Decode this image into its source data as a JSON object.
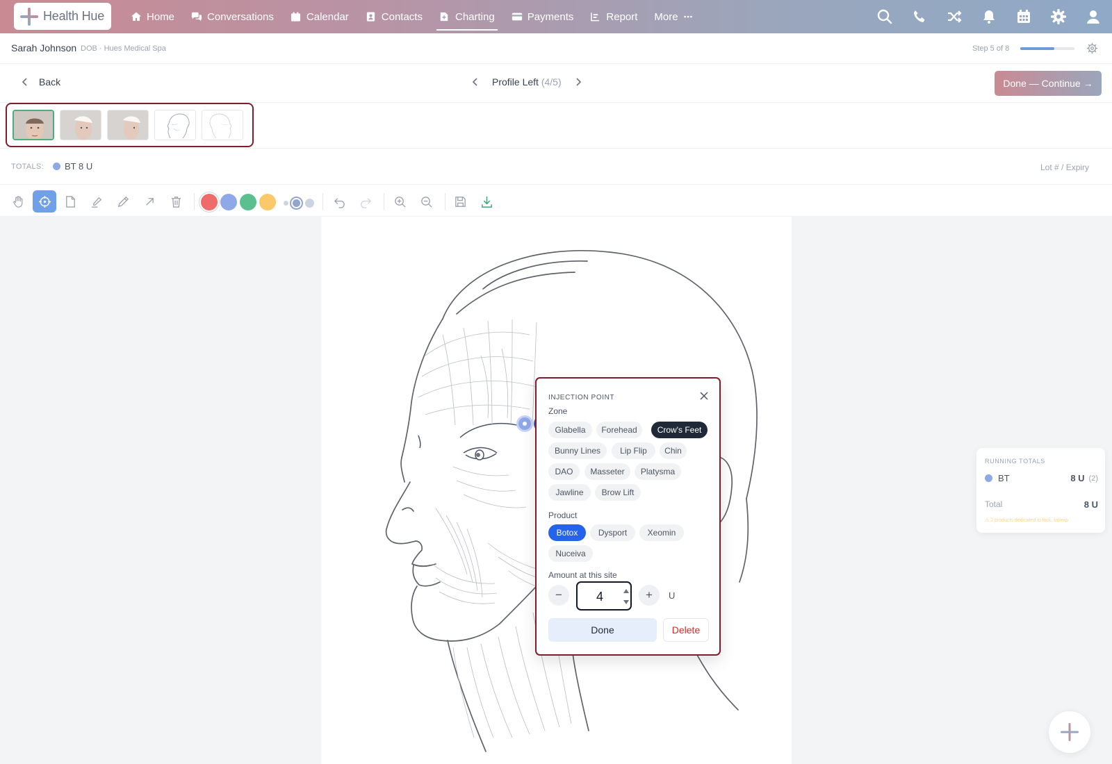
{
  "app": {
    "name": "Health Hue"
  },
  "nav": {
    "items": [
      {
        "label": "Home",
        "icon": "home-icon"
      },
      {
        "label": "Conversations",
        "icon": "chat-icon"
      },
      {
        "label": "Calendar",
        "icon": "calendar-icon"
      },
      {
        "label": "Contacts",
        "icon": "contact-icon"
      },
      {
        "label": "Charting",
        "icon": "document-icon",
        "active": true
      },
      {
        "label": "Payments",
        "icon": "card-icon"
      },
      {
        "label": "Report",
        "icon": "report-icon"
      },
      {
        "label": "More",
        "icon": "more-icon"
      }
    ],
    "right_icons": [
      "search-icon",
      "phone-icon",
      "shuffle-icon",
      "bell-icon",
      "calendar-icon",
      "gear-icon",
      "user-icon"
    ]
  },
  "patient": {
    "name": "Sarah Johnson",
    "meta": "DOB · Hues Medical Spa",
    "step_text": "Step 5 of 8",
    "step_progress": 0.625
  },
  "view": {
    "back_label": "Back",
    "title": "Profile Left",
    "count": "(4/5)",
    "continue_label": "Done — Continue →"
  },
  "totals": {
    "label": "TOTALS:",
    "chip": "BT 8 U",
    "lot_label": "Lot # / Expiry"
  },
  "colors": {
    "red": "#ef6b6b",
    "blue": "#8fa9e8",
    "green": "#5cbf8f",
    "yellow": "#f9c96b",
    "accent": "#2563eb",
    "brand_start": "#c98a93",
    "brand_end": "#8fa9c7"
  },
  "popup": {
    "title": "INJECTION POINT",
    "zone_label": "Zone",
    "zones": [
      "Glabella",
      "Forehead",
      "Crow's Feet",
      "Bunny Lines",
      "Lip Flip",
      "Chin",
      "DAO",
      "Masseter",
      "Platysma",
      "Jawline",
      "Brow Lift"
    ],
    "selected_zone": "Crow's Feet",
    "product_label": "Product",
    "products": [
      "Botox",
      "Dysport",
      "Xeomin",
      "Nuceiva"
    ],
    "selected_product": "Botox",
    "amount_label": "Amount at this site",
    "amount": "4",
    "minus": "−",
    "plus": "+",
    "unit": "U",
    "done_label": "Done",
    "delete_label": "Delete"
  },
  "running_totals": {
    "title": "RUNNING TOTALS",
    "rows": [
      {
        "name": "BT",
        "value": "8 U",
        "count": "(2)"
      }
    ],
    "total_label": "Total",
    "total_value": "8 U",
    "warning": "⚠ 2 products dedicated to lock, lot/exp"
  }
}
